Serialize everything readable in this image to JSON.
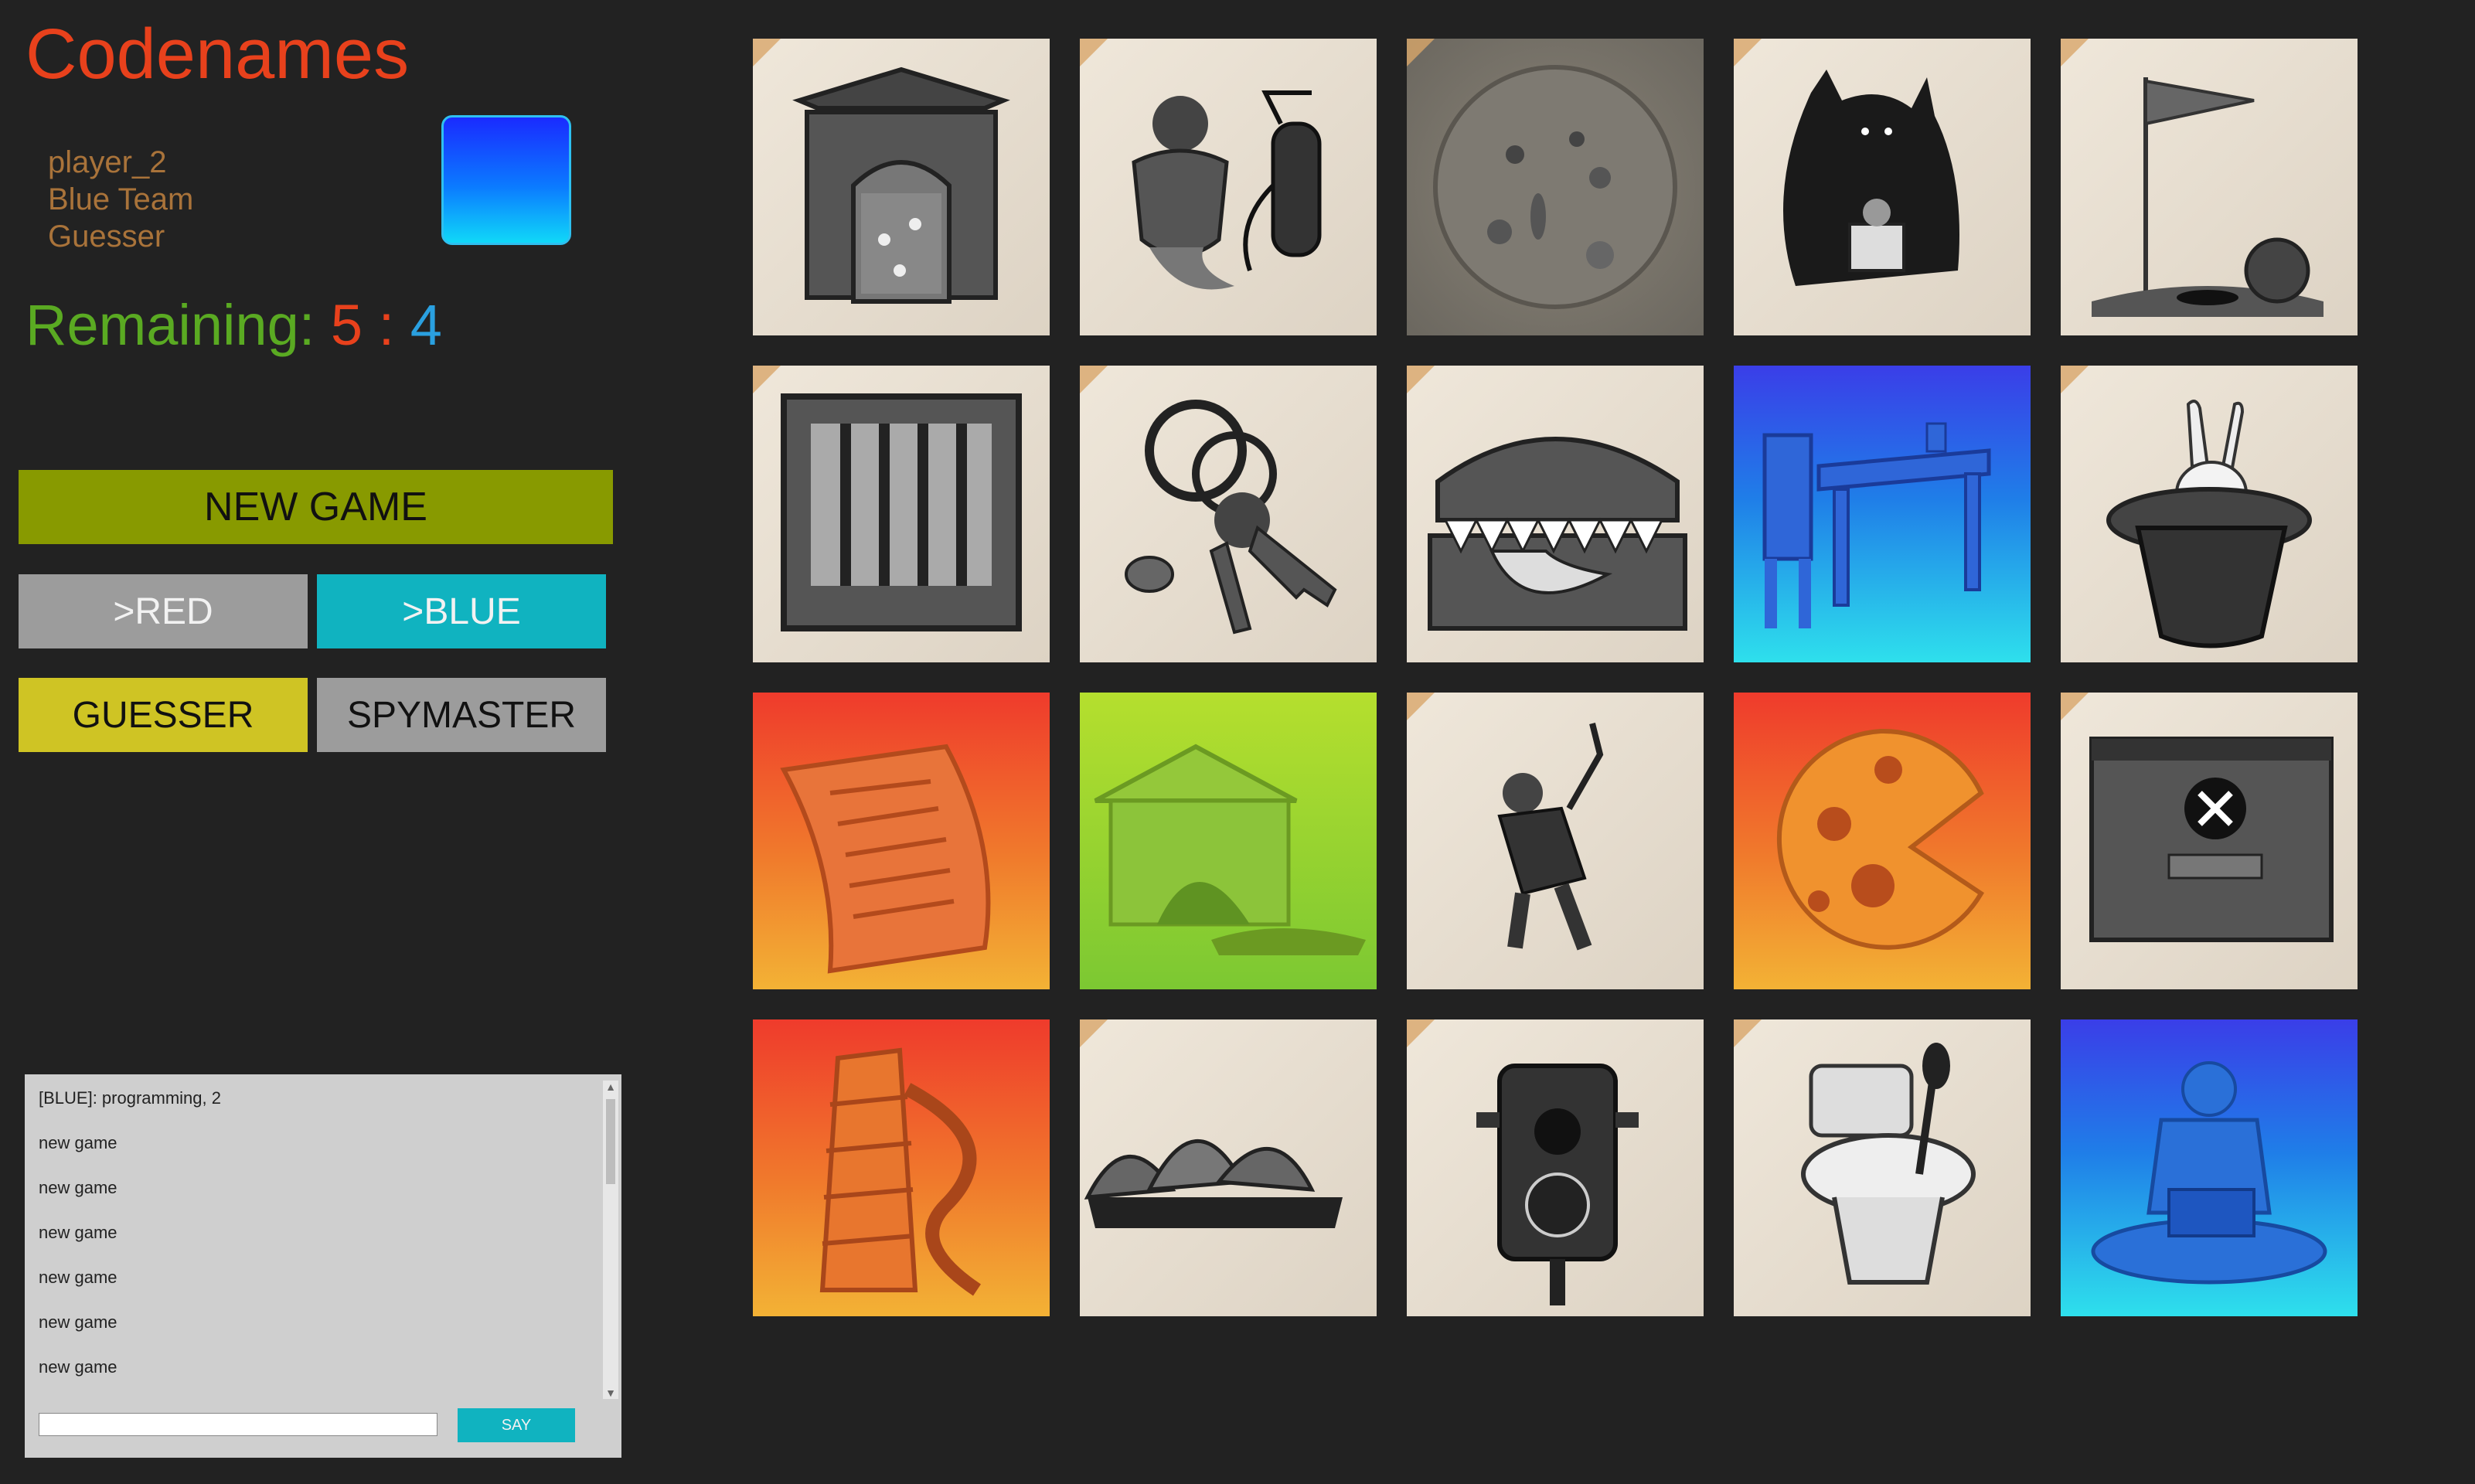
{
  "app": {
    "title": "Codenames"
  },
  "player": {
    "name": "player_2",
    "team": "Blue Team",
    "role": "Guesser",
    "team_color": "#1a2bff"
  },
  "remaining": {
    "label": "Remaining:",
    "red": "5",
    "separator": ":",
    "blue": "4"
  },
  "buttons": {
    "new_game": "NEW GAME",
    "red": ">RED",
    "blue": ">BLUE",
    "guesser": "GUESSER",
    "spymaster": "SPYMASTER"
  },
  "chat": {
    "messages": [
      "[BLUE]: programming, 2",
      "new game",
      "new game",
      "new game",
      "new game",
      "new game",
      "new game"
    ],
    "input_value": "",
    "say_label": "SAY"
  },
  "colors": {
    "red_team": "#e8411c",
    "blue_team": "#2aa0e0",
    "remaining_label": "#5aaa22",
    "neutral_card": "#e6ddd0"
  },
  "board": {
    "cards": [
      {
        "image": "gate-icon",
        "revealed": "none"
      },
      {
        "image": "genie-extinguisher-icon",
        "revealed": "none"
      },
      {
        "image": "petri-dish-icon",
        "revealed": "none"
      },
      {
        "image": "shadow-creature-reading-icon",
        "revealed": "none"
      },
      {
        "image": "golf-flag-ball-icon",
        "revealed": "none"
      },
      {
        "image": "jail-window-icon",
        "revealed": "none"
      },
      {
        "image": "keys-pacifier-icon",
        "revealed": "none"
      },
      {
        "image": "mimic-chest-icon",
        "revealed": "none"
      },
      {
        "image": "desk-chair-icon",
        "revealed": "blue"
      },
      {
        "image": "rabbit-top-hat-icon",
        "revealed": "none"
      },
      {
        "image": "maze-carpet-icon",
        "revealed": "red"
      },
      {
        "image": "temple-tent-icon",
        "revealed": "neutral"
      },
      {
        "image": "hockey-player-icon",
        "revealed": "none"
      },
      {
        "image": "cheese-moon-icon",
        "revealed": "red"
      },
      {
        "image": "error-dialog-icon",
        "revealed": "none"
      },
      {
        "image": "leaning-tower-slide-icon",
        "revealed": "red"
      },
      {
        "image": "opera-house-icon",
        "revealed": "none"
      },
      {
        "image": "traffic-light-icon",
        "revealed": "none"
      },
      {
        "image": "toilet-brush-icon",
        "revealed": "none"
      },
      {
        "image": "meditating-laptop-icon",
        "revealed": "blue"
      }
    ]
  }
}
